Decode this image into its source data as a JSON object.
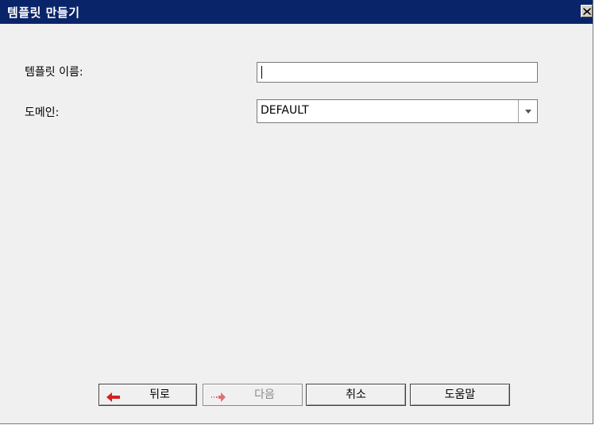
{
  "window": {
    "title": "템플릿 만들기",
    "close_icon": "close-icon"
  },
  "form": {
    "template_name_label": "템플릿 이름:",
    "template_name_value": "",
    "domain_label": "도메인:",
    "domain_value": "DEFAULT"
  },
  "buttons": {
    "back_label": "뒤로",
    "back_icon": "arrow-left-icon",
    "next_label": "다음",
    "next_icon": "arrow-right-icon",
    "next_enabled": false,
    "cancel_label": "취소",
    "help_label": "도움말"
  },
  "colors": {
    "titlebar": "#0a246a",
    "title_text": "#ffffff",
    "background": "#f0f0f0",
    "back_arrow": "#d62020",
    "next_arrow_disabled": "#e07070"
  }
}
